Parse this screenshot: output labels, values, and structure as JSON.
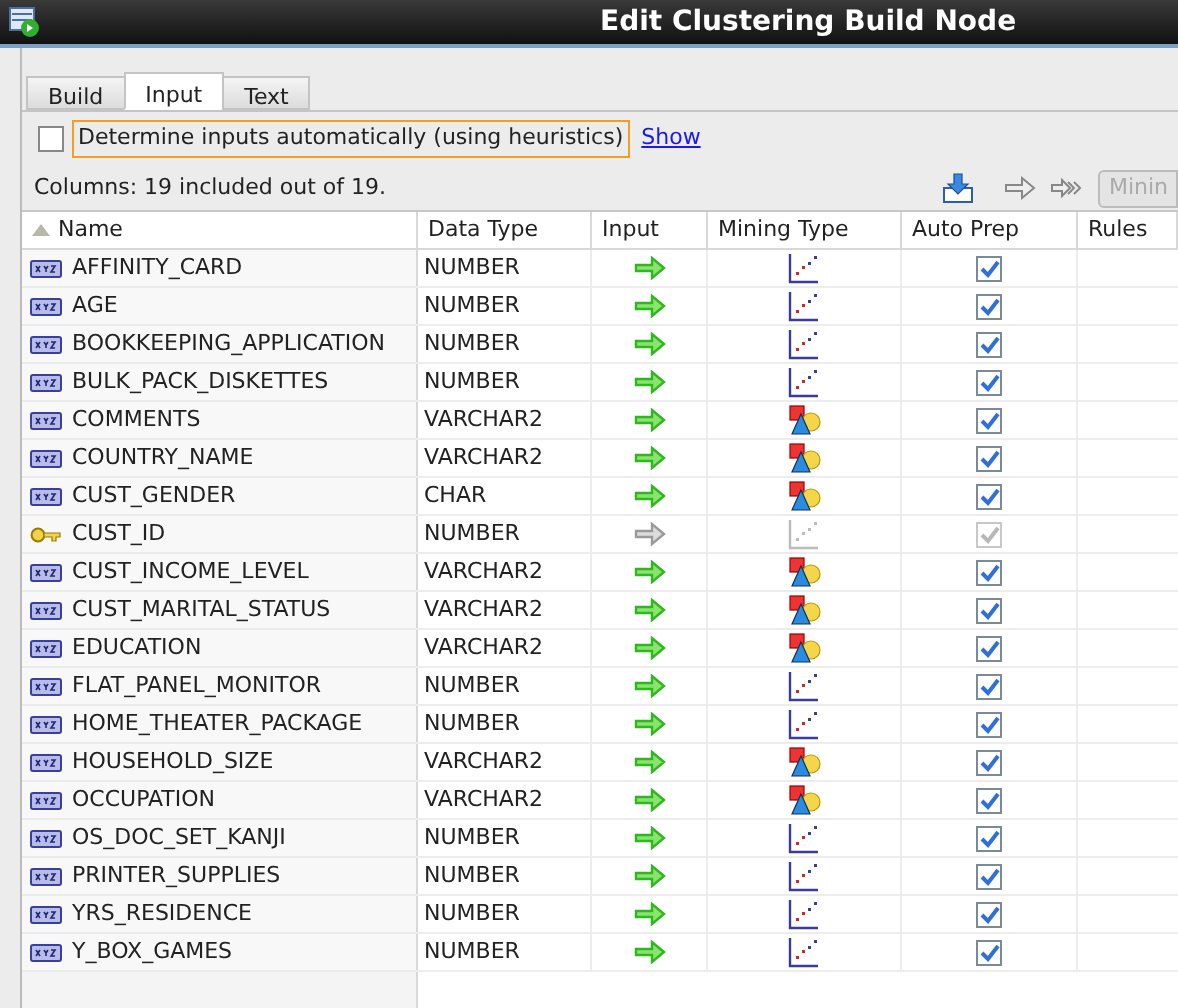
{
  "window": {
    "title": "Edit Clustering Build Node"
  },
  "tabs": [
    {
      "label": "Build",
      "selected": false
    },
    {
      "label": "Input",
      "selected": true
    },
    {
      "label": "Text",
      "selected": false
    }
  ],
  "auto_inputs": {
    "label": "Determine inputs automatically (using heuristics)",
    "checked": false,
    "link": "Show"
  },
  "toolbar": {
    "summary": "Columns: 19 included out of 19.",
    "cut_button": "Minin"
  },
  "table": {
    "columns": [
      "Name",
      "Data Type",
      "Input",
      "Mining Type",
      "Auto Prep",
      "Rules"
    ],
    "rows": [
      {
        "name": "AFFINITY_CARD",
        "kind": "column",
        "data_type": "NUMBER",
        "enabled": true,
        "mining_type": {
          "kind": "numerical"
        },
        "auto_prep": true
      },
      {
        "name": "AGE",
        "kind": "column",
        "data_type": "NUMBER",
        "enabled": true,
        "mining_type": {
          "kind": "numerical"
        },
        "auto_prep": true
      },
      {
        "name": "BOOKKEEPING_APPLICATION",
        "kind": "column",
        "data_type": "NUMBER",
        "enabled": true,
        "mining_type": {
          "kind": "numerical"
        },
        "auto_prep": true
      },
      {
        "name": "BULK_PACK_DISKETTES",
        "kind": "column",
        "data_type": "NUMBER",
        "enabled": true,
        "mining_type": {
          "kind": "numerical"
        },
        "auto_prep": true
      },
      {
        "name": "COMMENTS",
        "kind": "column",
        "data_type": "VARCHAR2",
        "enabled": true,
        "mining_type": {
          "kind": "categorical"
        },
        "auto_prep": true
      },
      {
        "name": "COUNTRY_NAME",
        "kind": "column",
        "data_type": "VARCHAR2",
        "enabled": true,
        "mining_type": {
          "kind": "categorical"
        },
        "auto_prep": true
      },
      {
        "name": "CUST_GENDER",
        "kind": "column",
        "data_type": "CHAR",
        "enabled": true,
        "mining_type": {
          "kind": "categorical"
        },
        "auto_prep": true
      },
      {
        "name": "CUST_ID",
        "kind": "key",
        "data_type": "NUMBER",
        "enabled": false,
        "mining_type": {
          "kind": "numerical"
        },
        "auto_prep": true
      },
      {
        "name": "CUST_INCOME_LEVEL",
        "kind": "column",
        "data_type": "VARCHAR2",
        "enabled": true,
        "mining_type": {
          "kind": "categorical"
        },
        "auto_prep": true
      },
      {
        "name": "CUST_MARITAL_STATUS",
        "kind": "column",
        "data_type": "VARCHAR2",
        "enabled": true,
        "mining_type": {
          "kind": "categorical"
        },
        "auto_prep": true
      },
      {
        "name": "EDUCATION",
        "kind": "column",
        "data_type": "VARCHAR2",
        "enabled": true,
        "mining_type": {
          "kind": "categorical"
        },
        "auto_prep": true
      },
      {
        "name": "FLAT_PANEL_MONITOR",
        "kind": "column",
        "data_type": "NUMBER",
        "enabled": true,
        "mining_type": {
          "kind": "numerical"
        },
        "auto_prep": true
      },
      {
        "name": "HOME_THEATER_PACKAGE",
        "kind": "column",
        "data_type": "NUMBER",
        "enabled": true,
        "mining_type": {
          "kind": "numerical"
        },
        "auto_prep": true
      },
      {
        "name": "HOUSEHOLD_SIZE",
        "kind": "column",
        "data_type": "VARCHAR2",
        "enabled": true,
        "mining_type": {
          "kind": "categorical"
        },
        "auto_prep": true
      },
      {
        "name": "OCCUPATION",
        "kind": "column",
        "data_type": "VARCHAR2",
        "enabled": true,
        "mining_type": {
          "kind": "categorical"
        },
        "auto_prep": true
      },
      {
        "name": "OS_DOC_SET_KANJI",
        "kind": "column",
        "data_type": "NUMBER",
        "enabled": true,
        "mining_type": {
          "kind": "numerical"
        },
        "auto_prep": true
      },
      {
        "name": "PRINTER_SUPPLIES",
        "kind": "column",
        "data_type": "NUMBER",
        "enabled": true,
        "mining_type": {
          "kind": "numerical"
        },
        "auto_prep": true
      },
      {
        "name": "YRS_RESIDENCE",
        "kind": "column",
        "data_type": "NUMBER",
        "enabled": true,
        "mining_type": {
          "kind": "numerical"
        },
        "auto_prep": true
      },
      {
        "name": "Y_BOX_GAMES",
        "kind": "column",
        "data_type": "NUMBER",
        "enabled": true,
        "mining_type": {
          "kind": "numerical"
        },
        "auto_prep": true
      }
    ]
  }
}
